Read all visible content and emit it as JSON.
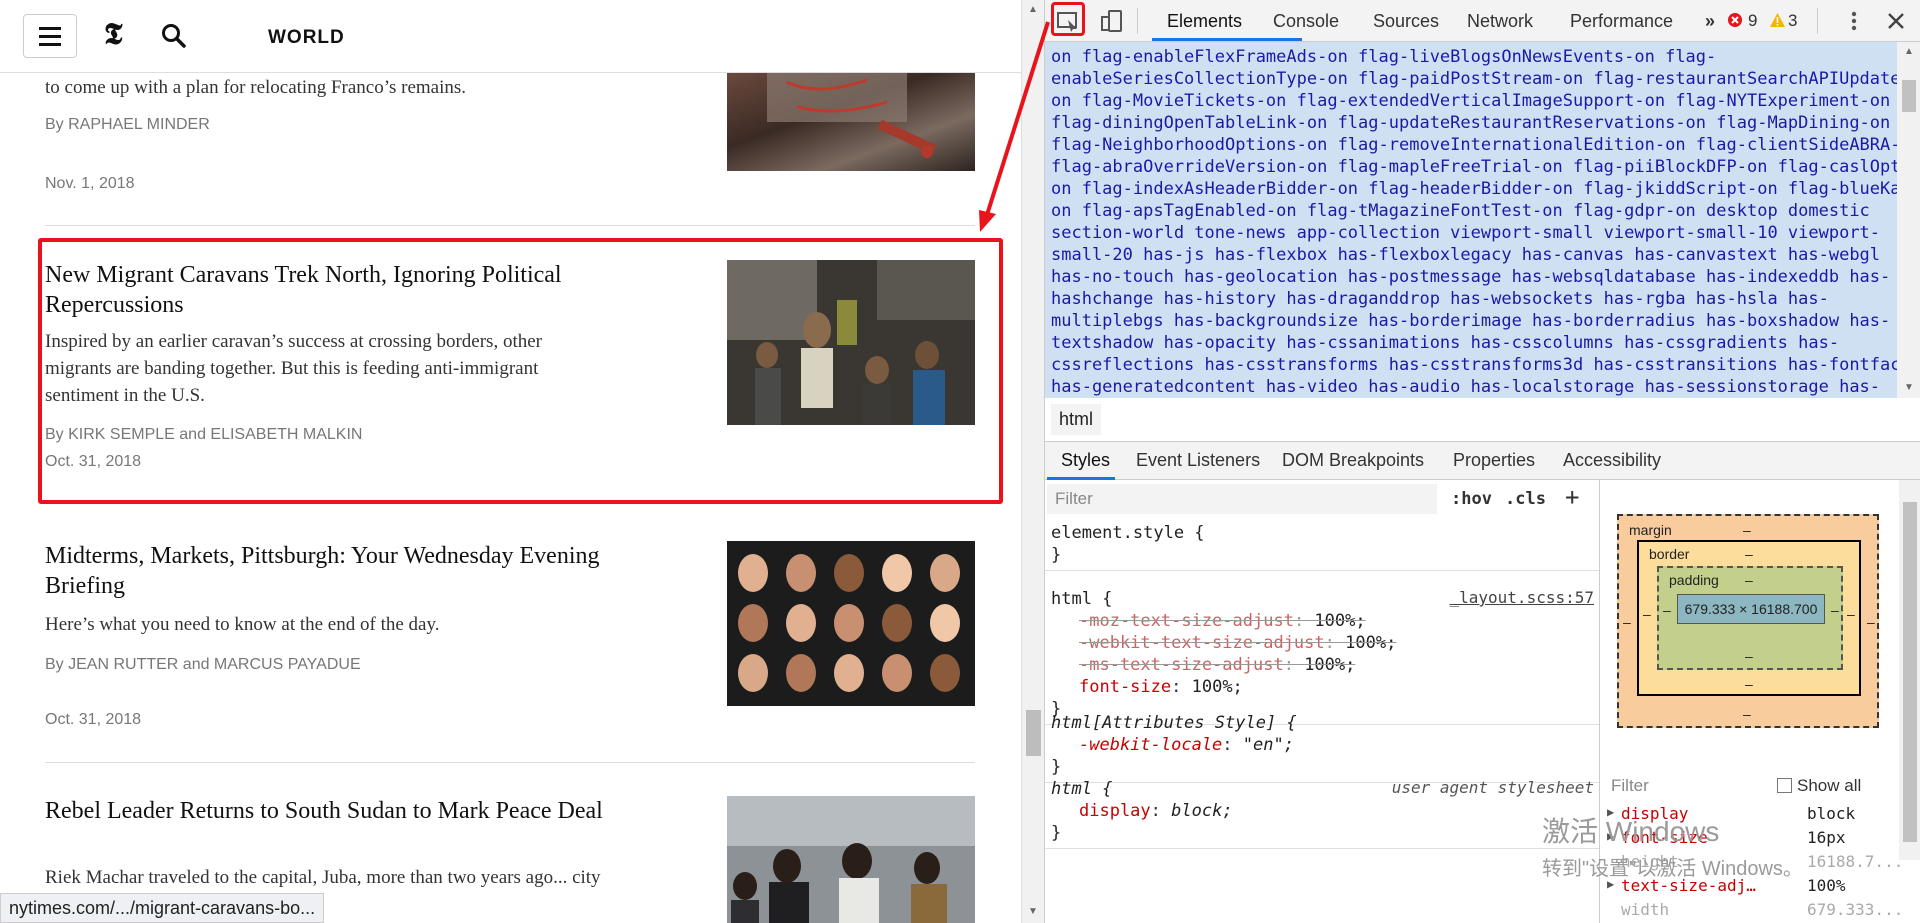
{
  "page": {
    "section_title": "WORLD",
    "status_url": "nytimes.com/.../migrant-caravans-bo..."
  },
  "stories": [
    {
      "headline": "",
      "summary": "to come up with a plan for relocating Franco’s remains.",
      "byline": "By RAPHAEL MINDER",
      "date": "Nov. 1, 2018"
    },
    {
      "headline": "New Migrant Caravans Trek North, Ignoring Political Repercussions",
      "summary": "Inspired by an earlier caravan’s success at crossing borders, other migrants are banding together. But this is feeding anti-immigrant sentiment in the U.S.",
      "byline": "By KIRK SEMPLE and ELISABETH MALKIN",
      "date": "Oct. 31, 2018"
    },
    {
      "headline": "Midterms, Markets, Pittsburgh: Your Wednesday Evening Briefing",
      "summary": "Here’s what you need to know at the end of the day.",
      "byline": "By JEAN RUTTER and MARCUS PAYADUE",
      "date": "Oct. 31, 2018"
    },
    {
      "headline": "Rebel Leader Returns to South Sudan to Mark Peace Deal",
      "summary": "Riek Machar traveled to the capital, Juba, more than two years ago... city and forced him to flee",
      "byline": "",
      "date": ""
    }
  ],
  "devtools": {
    "tabs": [
      "Elements",
      "Console",
      "Sources",
      "Network",
      "Performance"
    ],
    "more_tabs": "»",
    "error_count": "9",
    "warning_count": "3",
    "dom_lines": [
      "on flag-enableFlexFrameAds-on flag-liveBlogsOnNewsEvents-on flag-",
      "enableSeriesCollectionType-on flag-paidPostStream-on flag-restaurantSearchAPIUpdate-",
      "on flag-MovieTickets-on flag-extendedVerticalImageSupport-on flag-NYTExperiment-on",
      "flag-diningOpenTableLink-on flag-updateRestaurantReservations-on flag-MapDining-on",
      "flag-NeighborhoodOptions-on flag-removeInternationalEdition-on flag-clientSideABRA-on",
      "flag-abraOverrideVersion-on flag-mapleFreeTrial-on flag-piiBlockDFP-on flag-caslOpt-",
      "on flag-indexAsHeaderBidder-on flag-headerBidder-on flag-jkiddScript-on flag-blueKai-",
      "on flag-apsTagEnabled-on flag-tMagazineFontTest-on flag-gdpr-on desktop domestic",
      "section-world tone-news app-collection viewport-small viewport-small-10 viewport-",
      "small-20 has-js has-flexbox has-flexboxlegacy has-canvas has-canvastext has-webgl",
      "has-no-touch has-geolocation has-postmessage has-websqldatabase has-indexeddb has-",
      "hashchange has-history has-draganddrop has-websockets has-rgba has-hsla has-",
      "multiplebgs has-backgroundsize has-borderimage has-borderradius has-boxshadow has-",
      "textshadow has-opacity has-cssanimations has-csscolumns has-cssgradients has-",
      "cssreflections has-csstransforms has-csstransforms3d has-csstransitions has-fontface",
      "has-generatedcontent has-video has-audio has-localstorage has-sessionstorage has-"
    ],
    "breadcrumb": "html",
    "sub_tabs": [
      "Styles",
      "Event Listeners",
      "DOM Breakpoints",
      "Properties",
      "Accessibility"
    ],
    "styles": {
      "filter_placeholder": "Filter",
      "hov": ":hov",
      "cls": ".cls",
      "plus": "+",
      "rules": [
        {
          "selector": "element.style {",
          "close": "}",
          "source": "",
          "props": []
        },
        {
          "selector": "html {",
          "close": "}",
          "source": "_layout.scss:57",
          "props": [
            {
              "name": "-moz-text-size-adjust",
              "value": "100%;",
              "struck": true
            },
            {
              "name": "-webkit-text-size-adjust",
              "value": "100%;",
              "struck": true
            },
            {
              "name": "-ms-text-size-adjust",
              "value": "100%;",
              "struck": true
            },
            {
              "name": "font-size",
              "value": "100%;",
              "struck": false
            }
          ]
        },
        {
          "selector": "html[Attributes Style] {",
          "close": "}",
          "source": "",
          "props": [
            {
              "name": "-webkit-locale",
              "value": "\"en\";",
              "struck": false
            }
          ]
        },
        {
          "selector": "html {",
          "close": "}",
          "source": "user agent stylesheet",
          "props": [
            {
              "name": "display",
              "value": "block;",
              "struck": false
            }
          ]
        }
      ]
    },
    "box_model": {
      "margin_label": "margin",
      "border_label": "border",
      "padding_label": "padding",
      "dash": "–",
      "content_size": "679.333 × 16188.700"
    },
    "computed": {
      "filter_placeholder": "Filter",
      "show_all": "Show all",
      "rows": [
        {
          "name": "display",
          "value": "block"
        },
        {
          "name": "font-size",
          "value": "16px"
        },
        {
          "name": "height",
          "value": "16188.7..."
        },
        {
          "name": "text-size-adj…",
          "value": "100%"
        },
        {
          "name": "width",
          "value": "679.333..."
        }
      ]
    }
  },
  "watermark": {
    "line1": "激活 Windows",
    "line2": "转到\"设置\"以激活 Windows。"
  },
  "colors": {
    "highlight_red": "#e8131b",
    "devtools_blue": "#1a73e8",
    "dom_selection": "#cfe0f3"
  }
}
